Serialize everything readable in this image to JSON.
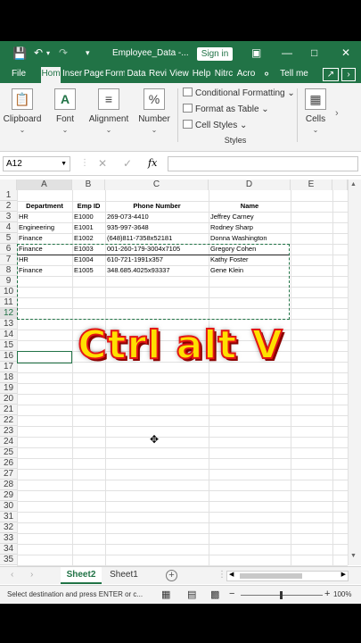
{
  "titlebar": {
    "filename": "Employee_Data  -...",
    "signin": "Sign in"
  },
  "ribbon_tabs": [
    "File",
    "Hom",
    "Inser",
    "Page",
    "Form",
    "Data",
    "Revi",
    "View",
    "Help",
    "Nitrc",
    "Acro"
  ],
  "tellme": "Tell me",
  "ribbon": {
    "clipboard": "Clipboard",
    "font": "Font",
    "alignment": "Alignment",
    "number": "Number",
    "cond_format": "Conditional Formatting",
    "format_table": "Format as Table",
    "cell_styles": "Cell Styles",
    "styles_group": "Styles",
    "cells": "Cells"
  },
  "formula_bar": {
    "namebox": "A12",
    "fx": "fx",
    "value": ""
  },
  "columns": [
    "A",
    "B",
    "C",
    "D",
    "E"
  ],
  "rows": [
    "1",
    "2",
    "3",
    "4",
    "5",
    "6",
    "7",
    "8",
    "9",
    "10",
    "11",
    "12",
    "13",
    "14",
    "15",
    "16",
    "17",
    "18",
    "19",
    "20",
    "21",
    "22",
    "23",
    "24",
    "25",
    "26",
    "27",
    "28",
    "29",
    "30",
    "31",
    "32",
    "33",
    "34",
    "35"
  ],
  "table": {
    "headers": [
      "Department",
      "Emp ID",
      "Phone Number",
      "Name"
    ],
    "rows": [
      [
        "HR",
        "E1000",
        "269-073-4410",
        "Jeffrey Carney"
      ],
      [
        "Engineering",
        "E1001",
        "935-997-3648",
        "Rodney Sharp"
      ],
      [
        "Finance",
        "E1002",
        "(648)811-7358x52181",
        "Donna Washington"
      ],
      [
        "Finance",
        "E1003",
        "001-260-179-3004x7105",
        "Gregory Cohen"
      ],
      [
        "HR",
        "E1004",
        "610-721-1991x357",
        "Kathy Foster"
      ],
      [
        "Finance",
        "E1005",
        "348.685.4025x93337",
        "Gene Klein"
      ]
    ]
  },
  "overlay_text": "Ctrl  alt  V",
  "sheet_tabs": [
    "Sheet2",
    "Sheet1"
  ],
  "status": {
    "message": "Select destination and press ENTER or c...",
    "zoom": "100%"
  }
}
